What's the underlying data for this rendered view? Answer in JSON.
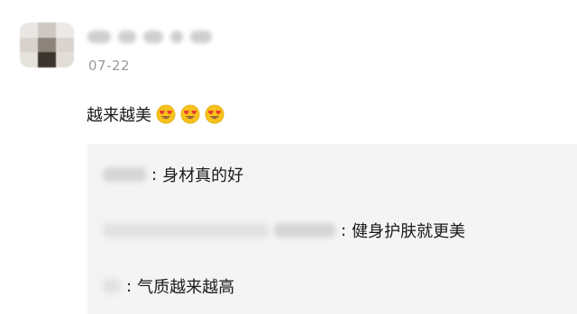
{
  "post": {
    "date": "07-22",
    "comment_text": "越来越美",
    "comment_emojis": [
      "heart-eyes-emoji",
      "heart-eyes-emoji",
      "heart-eyes-emoji"
    ]
  },
  "replies": [
    {
      "separator": ":",
      "text": "身材真的好"
    },
    {
      "separator": ":",
      "text": "健身护肤就更美"
    },
    {
      "separator": ":",
      "text": "气质越来越高"
    }
  ],
  "colors": {
    "reply_background": "#f4f4f4",
    "date_text": "#9a9a9a",
    "body_text": "#1a1a1a"
  }
}
